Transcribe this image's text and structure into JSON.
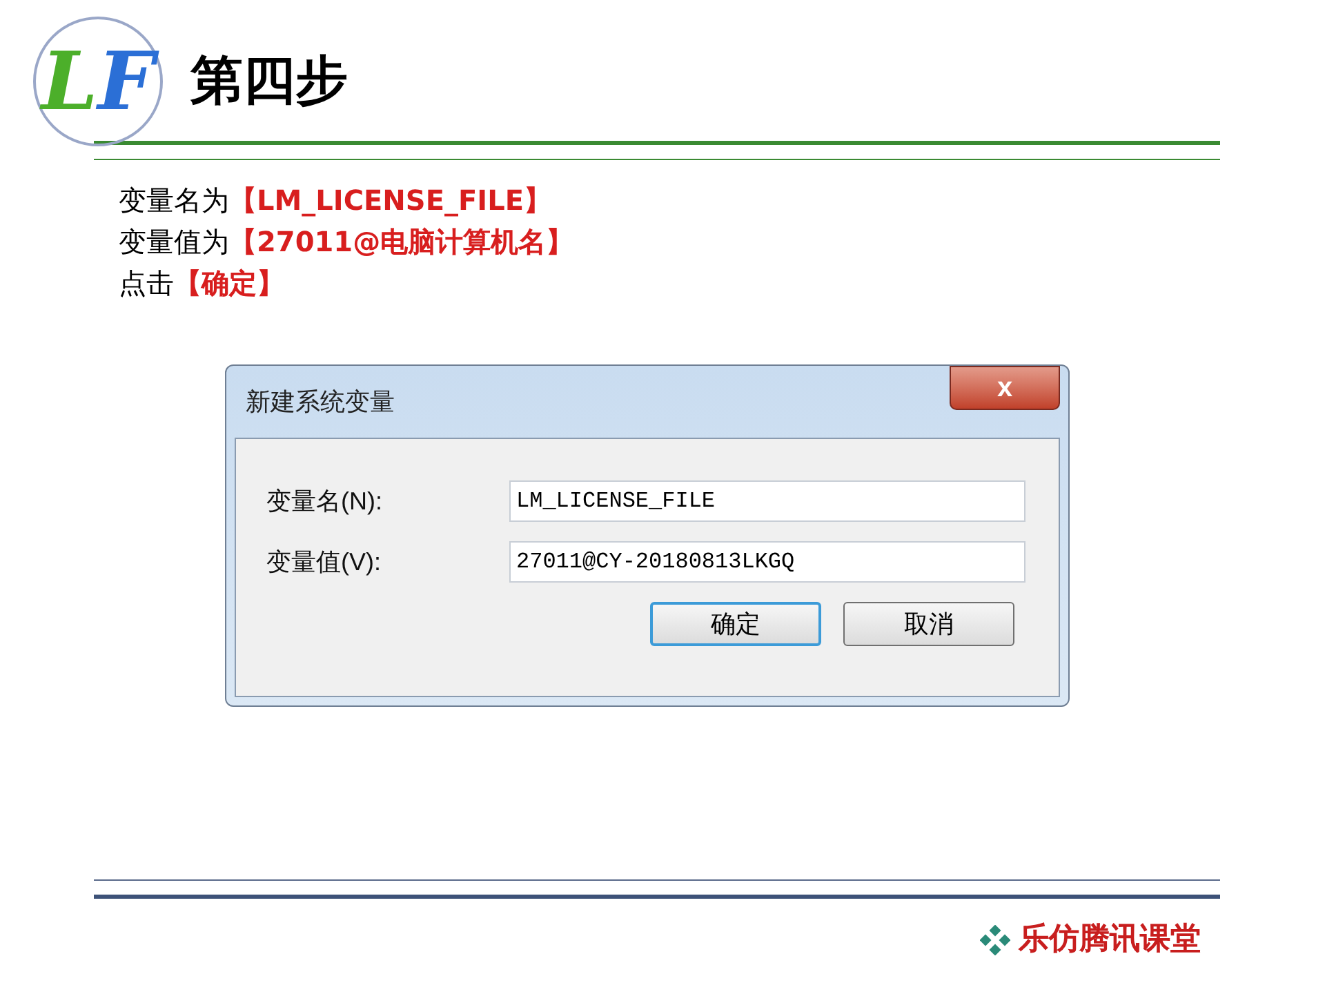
{
  "logo": {
    "letters": [
      "L",
      "F"
    ]
  },
  "title": "第四步",
  "instructions": [
    {
      "text": "变量名为",
      "highlight": "【LM_LICENSE_FILE】"
    },
    {
      "text": "变量值为",
      "highlight": "【27011@电脑计算机名】"
    },
    {
      "text": "点击",
      "highlight": "【确定】"
    }
  ],
  "dialog": {
    "title": "新建系统变量",
    "close": "x",
    "fields": [
      {
        "label": "变量名(N):",
        "value": "LM_LICENSE_FILE"
      },
      {
        "label": "变量值(V):",
        "value": "27011@CY-20180813LKGQ"
      }
    ],
    "buttons": [
      {
        "label": "确定",
        "default": true
      },
      {
        "label": "取消",
        "default": false
      }
    ]
  },
  "footer": "乐仿腾讯课堂"
}
